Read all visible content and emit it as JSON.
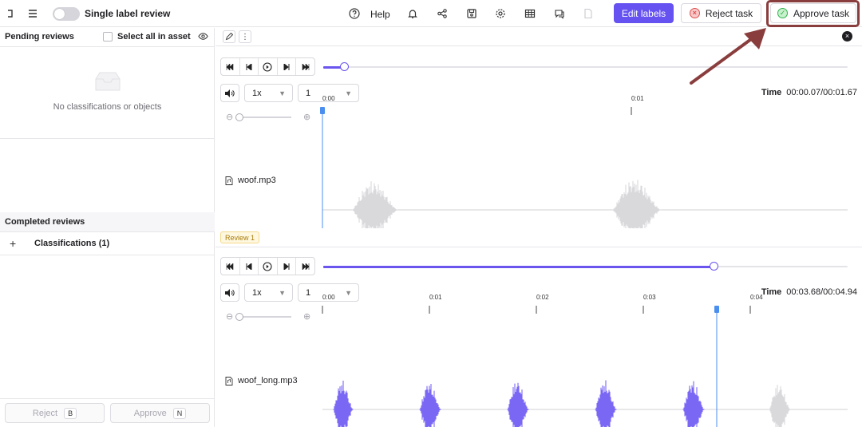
{
  "topbar": {
    "single_label": "Single label review",
    "help": "Help",
    "edit_labels": "Edit labels",
    "reject_task": "Reject task",
    "approve_task": "Approve task"
  },
  "left": {
    "pending_title": "Pending reviews",
    "select_all": "Select all in asset",
    "empty_text": "No classifications or objects",
    "completed_title": "Completed reviews",
    "classifications": "Classifications (1)",
    "reject_btn": "Reject",
    "reject_key": "B",
    "approve_btn": "Approve",
    "approve_key": "N"
  },
  "players": [
    {
      "file": "woof.mp3",
      "speed": "1x",
      "channel": "1",
      "time_label": "Time",
      "time": "00:00.07/00:01.67",
      "progress": 0.04,
      "ticks": [
        "0:00",
        "0:01"
      ]
    },
    {
      "file": "woof_long.mp3",
      "speed": "1x",
      "channel": "1",
      "time_label": "Time",
      "time": "00:03.68/00:04.94",
      "progress": 0.745,
      "ticks": [
        "0:00",
        "0:01",
        "0:02",
        "0:03",
        "0:04"
      ]
    }
  ],
  "review_badge": "Review 1",
  "colors": {
    "accent": "#6552f0",
    "wave_played": "#7b68f5",
    "wave_unplayed": "#d9d9dc",
    "cursor": "#4a8ff0",
    "highlight": "#8a3d3d"
  }
}
